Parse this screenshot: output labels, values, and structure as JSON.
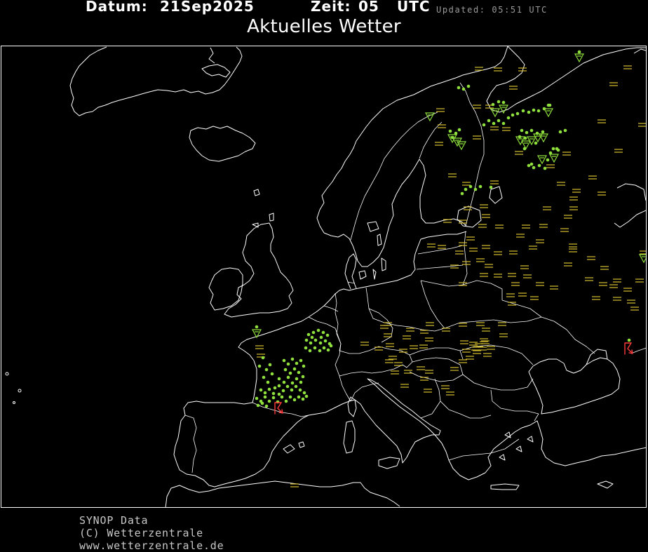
{
  "header": {
    "date_label": "Datum:",
    "date_value": "21Sep2025",
    "time_label": "Zeit:",
    "time_value": "05",
    "time_zone": "UTC",
    "updated": "Updated: 05:51 UTC"
  },
  "title": "Aktuelles Wetter",
  "footer": {
    "source": "SYNOP Data",
    "copyright": "(C) Wetterzentrale",
    "website": "www.wetterzentrale.de"
  },
  "map": {
    "background_color": "#000000",
    "outline_color": "#ffffff",
    "symbols": {
      "rain": {
        "icon": "rain-dot-icon",
        "color": "#8fe03c"
      },
      "fog": {
        "icon": "fog-icon",
        "color": "#cdb82e"
      },
      "shower": {
        "icon": "shower-triangle-icon",
        "color": "#8fe03c"
      },
      "thunderstorm": {
        "icon": "thunderstorm-icon",
        "color": "#ff3b3b"
      }
    }
  }
}
